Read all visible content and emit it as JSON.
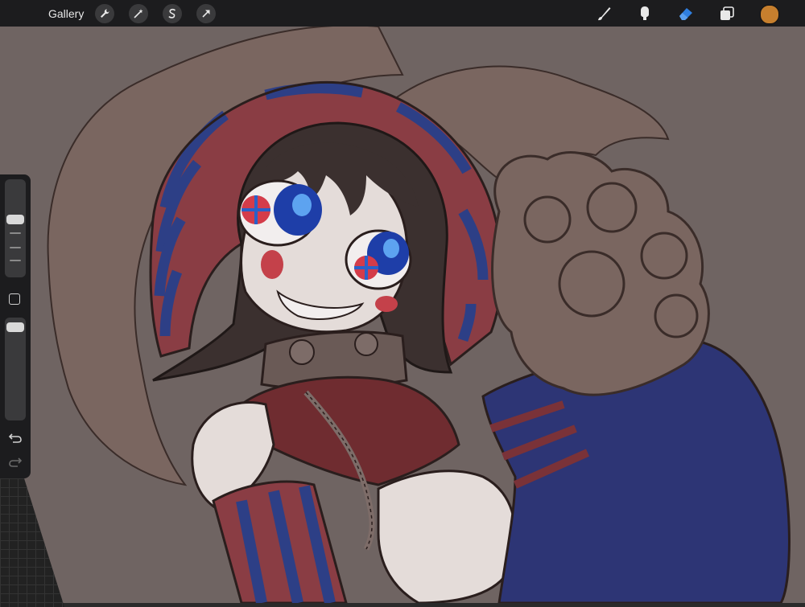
{
  "toolbar": {
    "gallery_label": "Gallery",
    "left_tools": [
      "wrench-icon",
      "magic-wand-icon",
      "selection-s-icon",
      "move-arrow-icon"
    ],
    "right_tools": [
      "brush-icon",
      "smudge-icon",
      "eraser-icon",
      "layers-icon"
    ],
    "active_tool": "eraser",
    "active_tool_color": "#2f7fe0",
    "current_color": "#c67f2e"
  },
  "sidebar": {
    "brush_size": 0.85,
    "opacity": 1.0,
    "buttons": [
      "modify-square-icon",
      "undo-icon",
      "redo-icon"
    ]
  },
  "canvas": {
    "background_color": "#6f6462",
    "artwork": "illustration-character-hood-wolf"
  }
}
